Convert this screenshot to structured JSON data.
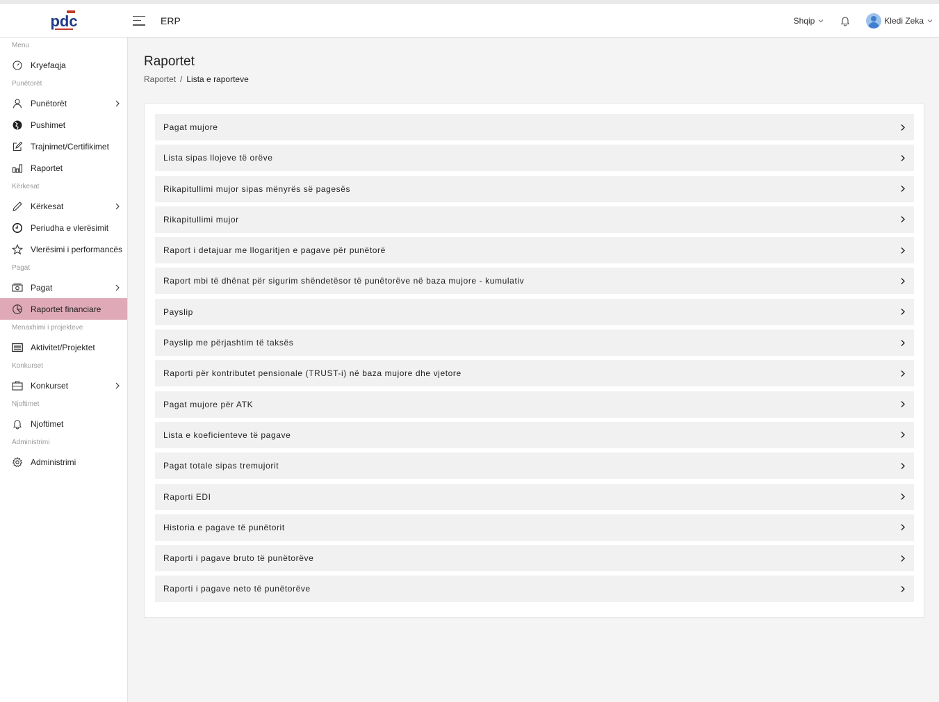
{
  "header": {
    "app_title": "ERP",
    "language": "Shqip",
    "user_name": "Kledi Zeka",
    "icons": [
      "menu-icon",
      "chevron-down-icon",
      "bell-icon",
      "user-avatar"
    ]
  },
  "sidebar": {
    "sections": {
      "menu": "Menu",
      "employees": "Punëtorët",
      "requests": "Kërkesat",
      "salaries": "Pagat",
      "projects": "Menaxhimi i projekteve",
      "competitions": "Konkurset",
      "notifications": "Njoftimet",
      "admin": "Administrimi"
    },
    "items": [
      {
        "label": "Kryefaqja",
        "icon": "dashboard-icon"
      },
      {
        "label": "Punëtorët",
        "icon": "user-icon"
      },
      {
        "label": "Pushimet",
        "icon": "globe-icon"
      },
      {
        "label": "Trajnimet/Certifikimet",
        "icon": "edit-icon"
      },
      {
        "label": "Raportet",
        "icon": "bar-chart-icon"
      },
      {
        "label": "Kërkesat",
        "icon": "pencil-icon"
      },
      {
        "label": "Periudha e vlerësimit",
        "icon": "clock-icon"
      },
      {
        "label": "Vlerësimi i performancës",
        "icon": "star-icon"
      },
      {
        "label": "Pagat",
        "icon": "money-icon"
      },
      {
        "label": "Raportet financiare",
        "icon": "pie-chart-icon"
      },
      {
        "label": "Aktivitet/Projektet",
        "icon": "list-icon"
      },
      {
        "label": "Konkurset",
        "icon": "briefcase-icon"
      },
      {
        "label": "Njoftimet",
        "icon": "bell-icon"
      },
      {
        "label": "Administrimi",
        "icon": "gear-icon"
      }
    ],
    "active_color": "#dfa9b8"
  },
  "page": {
    "title": "Raportet",
    "breadcrumb": {
      "link": "Raportet",
      "separator": "/",
      "current": "Lista e raporteve"
    }
  },
  "reports": [
    {
      "label": "Pagat mujore"
    },
    {
      "label": "Lista sipas llojeve të orëve"
    },
    {
      "label": "Rikapitullimi mujor sipas mënyrës së pagesës"
    },
    {
      "label": "Rikapitullimi mujor"
    },
    {
      "label": "Raport i detajuar me llogaritjen e pagave për punëtorë"
    },
    {
      "label": "Raport mbi të dhënat për sigurim shëndetësor të punëtorëve në baza mujore - kumulativ"
    },
    {
      "label": "Payslip"
    },
    {
      "label": "Payslip me përjashtim të taksës"
    },
    {
      "label": "Raporti për kontributet pensionale (TRUST-i) në baza mujore dhe vjetore"
    },
    {
      "label": "Pagat mujore për ATK"
    },
    {
      "label": "Lista e koeficienteve të pagave"
    },
    {
      "label": "Pagat totale sipas tremujorit"
    },
    {
      "label": "Raporti EDI"
    },
    {
      "label": "Historia e pagave të punëtorit"
    },
    {
      "label": "Raporti i pagave bruto të punëtorëve"
    },
    {
      "label": "Raporti i pagave neto të punëtorëve"
    }
  ]
}
